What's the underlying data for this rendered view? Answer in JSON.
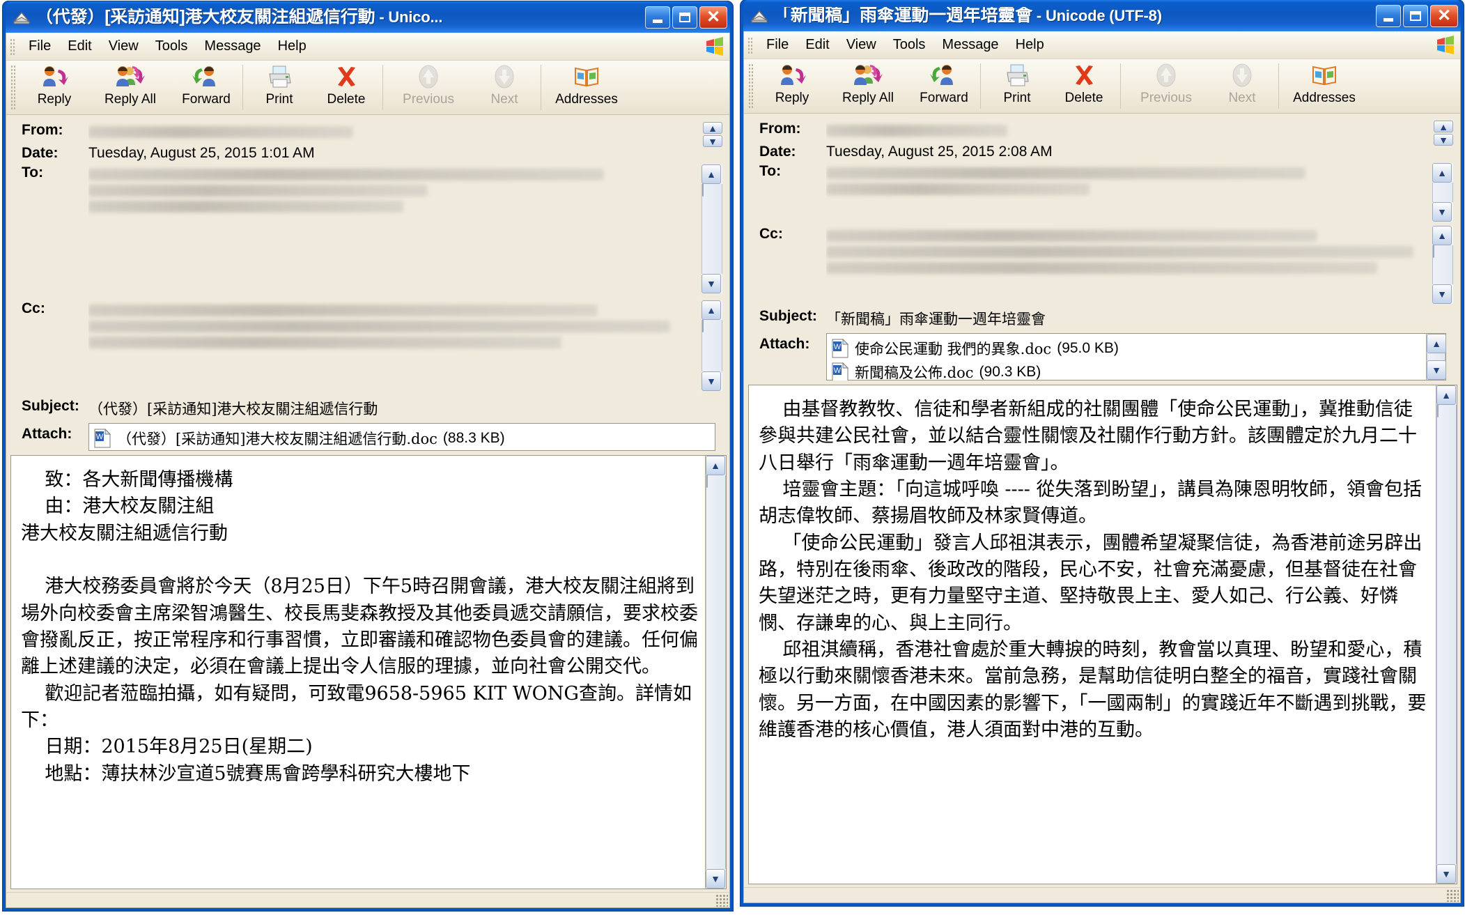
{
  "windows": [
    {
      "id": "left",
      "title": "（代發）[采訪通知]港大校友關注組遞信行動",
      "title_encoding": " - Unico...",
      "menu": [
        "File",
        "Edit",
        "View",
        "Tools",
        "Message",
        "Help"
      ],
      "toolbar": [
        {
          "label": "Reply",
          "icon": "reply-icon",
          "disabled": false
        },
        {
          "label": "Reply All",
          "icon": "reply-all-icon",
          "disabled": false
        },
        {
          "label": "Forward",
          "icon": "forward-icon",
          "disabled": false
        },
        {
          "label": "Print",
          "icon": "printer-icon",
          "disabled": false
        },
        {
          "label": "Delete",
          "icon": "delete-x-icon",
          "disabled": false
        },
        {
          "label": "Previous",
          "icon": "arrow-up-icon",
          "disabled": true
        },
        {
          "label": "Next",
          "icon": "arrow-down-icon",
          "disabled": true
        },
        {
          "label": "Addresses",
          "icon": "address-book-icon",
          "disabled": false
        }
      ],
      "fields": {
        "from_label": "From:",
        "from_value": "",
        "date_label": "Date:",
        "date_value": "Tuesday, August 25, 2015 1:01 AM",
        "to_label": "To:",
        "to_value": "",
        "cc_label": "Cc:",
        "cc_value": "",
        "subject_label": "Subject:",
        "subject_value": "（代發）[采訪通知]港大校友關注組遞信行動",
        "attach_label": "Attach:"
      },
      "attachments": [
        {
          "name": "（代發）[采訪通知]港大校友關注組遞信行動.doc",
          "size": "(88.3 KB)"
        }
      ],
      "body": "    致：各大新聞傳播機構\n    由：港大校友關注組\n港大校友關注組遞信行動\n\n    港大校務委員會將於今天（8月25日）下午5時召開會議，港大校友關注組將到場外向校委會主席梁智鴻醫生、校長馬斐森教授及其他委員遞交請願信，要求校委會撥亂反正，按正常程序和行事習慣，立即審議和確認物色委員會的建議。任何偏離上述建議的決定，必須在會議上提出令人信服的理據，並向社會公開交代。\n    歡迎記者蒞臨拍攝，如有疑問，可致電9658-5965 KIT WONG查詢。詳情如下：\n    日期：2015年8月25日(星期二)\n    地點：薄扶林沙宣道5號賽馬會跨學科研究大樓地下"
    },
    {
      "id": "right",
      "title": "「新聞稿」雨傘運動一週年培靈會",
      "title_encoding": " - Unicode (UTF-8)",
      "menu": [
        "File",
        "Edit",
        "View",
        "Tools",
        "Message",
        "Help"
      ],
      "toolbar": [
        {
          "label": "Reply",
          "icon": "reply-icon",
          "disabled": false
        },
        {
          "label": "Reply All",
          "icon": "reply-all-icon",
          "disabled": false
        },
        {
          "label": "Forward",
          "icon": "forward-icon",
          "disabled": false
        },
        {
          "label": "Print",
          "icon": "printer-icon",
          "disabled": false
        },
        {
          "label": "Delete",
          "icon": "delete-x-icon",
          "disabled": false
        },
        {
          "label": "Previous",
          "icon": "arrow-up-icon",
          "disabled": true
        },
        {
          "label": "Next",
          "icon": "arrow-down-icon",
          "disabled": true
        },
        {
          "label": "Addresses",
          "icon": "address-book-icon",
          "disabled": false
        }
      ],
      "fields": {
        "from_label": "From:",
        "from_value": "",
        "date_label": "Date:",
        "date_value": "Tuesday, August 25, 2015 2:08 AM",
        "to_label": "To:",
        "to_value": "",
        "cc_label": "Cc:",
        "cc_value": "",
        "subject_label": "Subject:",
        "subject_value": "「新聞稿」雨傘運動一週年培靈會",
        "attach_label": "Attach:"
      },
      "attachments": [
        {
          "name": "使命公民運動 我們的異象.doc",
          "size": "(95.0 KB)"
        },
        {
          "name": "新聞稿及公佈.doc",
          "size": "(90.3 KB)"
        }
      ],
      "body": "    由基督教教牧、信徒和學者新組成的社關團體「使命公民運動」，冀推動信徒參與共建公民社會，並以結合靈性關懷及社關作行動方針。該團體定於九月二十八日舉行「雨傘運動一週年培靈會」。\n    培靈會主題：「向這城呼喚 ---- 從失落到盼望」，講員為陳恩明牧師，領會包括胡志偉牧師、蔡揚眉牧師及林家賢傳道。\n    「使命公民運動」發言人邱祖淇表示，團體希望凝聚信徒，為香港前途另辟出路，特別在後雨傘、後政改的階段，民心不安，社會充滿憂慮，但基督徒在社會失望迷茫之時，更有力量堅守主道、堅持敬畏上主、愛人如己、行公義、好憐憫、存謙卑的心、與上主同行。\n    邱祖淇續稱，香港社會處於重大轉捩的時刻，教會當以真理、盼望和愛心，積極以行動來關懷香港未來。當前急務，是幫助信徒明白整全的福音，實踐社會關懷。另一方面，在中國因素的影響下，「一國兩制」的實踐近年不斷遇到挑戰，要維護香港的核心價值，港人須面對中港的互動。"
    }
  ],
  "window_buttons": {
    "minimize": "minimize-button",
    "maximize": "maximize-button",
    "close": "close-button"
  },
  "colors": {
    "titlebar_blue": "#0d58c0",
    "client_bg": "#efeadb",
    "close_red": "#e2512a",
    "delete_x": "#e03a1a"
  }
}
